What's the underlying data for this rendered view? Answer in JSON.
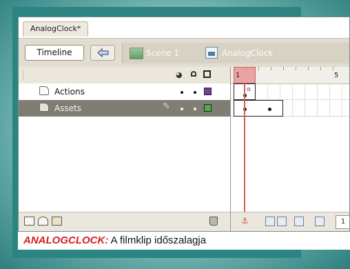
{
  "document_tab": {
    "title": "AnalogClock*"
  },
  "toolbar": {
    "timeline_button": "Timeline",
    "back_icon": "back-arrow-icon",
    "breadcrumb": {
      "scene_icon": "scene-clapper-icon",
      "scene_label": "Scene 1",
      "symbol_icon": "movieclip-symbol-icon",
      "symbol_label": "AnalogClock"
    }
  },
  "layer_header": {
    "icons": [
      "eye-icon",
      "lock-icon",
      "outline-icon"
    ]
  },
  "layers": [
    {
      "name": "Actions",
      "selected": false,
      "outline_color": "#7a3f9b",
      "eye_dot": true,
      "lock_dot": true
    },
    {
      "name": "Assets",
      "selected": true,
      "outline_color": "#46b046",
      "eye_dot": true,
      "lock_dot": true,
      "editing_icon": "pencil-icon"
    }
  ],
  "ruler": {
    "labels": [
      "1",
      "5"
    ],
    "current_frame": 1
  },
  "layer_footer": {
    "icons": [
      "insert-layer-icon",
      "add-motion-guide-icon",
      "insert-layer-folder-icon",
      "delete-layer-icon"
    ]
  },
  "timeline_footer": {
    "frame_counter": "1",
    "icons": [
      "center-frame-icon",
      "onion-skin-icon",
      "onion-skin-outlines-icon",
      "edit-multiple-frames-icon",
      "modify-onion-markers-icon"
    ]
  },
  "caption": {
    "heading": "ANALOGCLOCK:",
    "text": " A filmklip időszalagja"
  },
  "colors": {
    "background_teal": "#2c8482",
    "caption_heading": "#d31f1f",
    "playhead": "#d0604b"
  }
}
